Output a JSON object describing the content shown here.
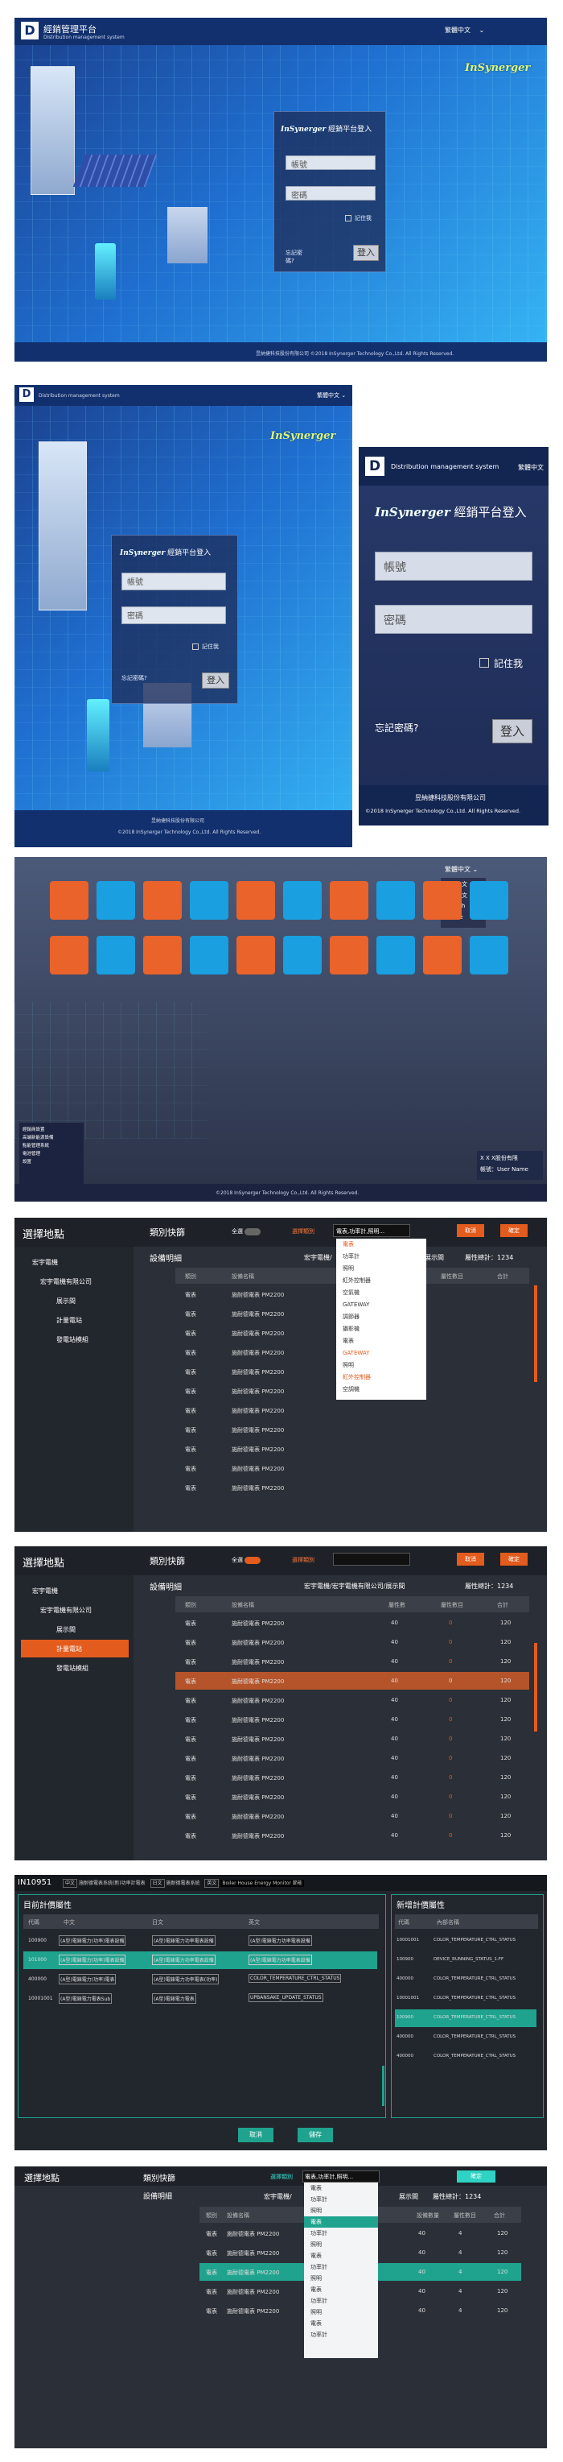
{
  "login1": {
    "brand_title": "經銷管理平台",
    "brand_sub": "Distribution management system",
    "lang": "繁體中文",
    "logo": "InSynerger",
    "box_title": "經銷平台登入",
    "box_logo": "InSynerger",
    "account_placeholder": "帳號",
    "password_placeholder": "密碼",
    "remember": "記住我",
    "forgot": "忘記密碼?",
    "login_btn": "登入",
    "footer": "昱納捷科技股份有限公司   ©2018 InSynerger Technology Co.,Ltd. All Rights Reserved."
  },
  "login2": {
    "brand_sub": "Distribution management system",
    "lang": "繁體中文",
    "logo": "InSynerger",
    "box_logo": "InSynerger",
    "box_title": "經銷平台登入",
    "account_placeholder": "帳號",
    "password_placeholder": "密碼",
    "remember": "記住我",
    "forgot": "忘記密碼?",
    "login_btn": "登入",
    "footer1": "昱納捷科技股份有限公司",
    "footer2": "©2018 InSynerger Technology Co.,Ltd. All Rights Reserved."
  },
  "login3": {
    "brand_sub": "Distribution management system",
    "lang": "繁體中文",
    "box_logo": "InSynerger",
    "box_title": "經銷平台登入",
    "account_placeholder": "帳號",
    "password_placeholder": "密碼",
    "remember": "記住我",
    "forgot": "忘記密碼?",
    "login_btn": "登入",
    "footer1": "昱納捷科技股份有限公司",
    "footer2": "©2018 InSynerger Technology Co.,Ltd. All Rights Reserved."
  },
  "menu": {
    "lang": "繁體中文",
    "lang_options": [
      "繁體中文",
      "簡體中文",
      "English",
      "Online"
    ],
    "user_company": "X X X股份有限",
    "user_label": "帳號：User Name",
    "footer": "©2018 InSynerger Technology Co.,Ltd. All Rights Reserved.",
    "side_links": [
      "經銷商設置",
      "高端新能源設備",
      "點能管理系統",
      "電池管理",
      "設置"
    ]
  },
  "app1": {
    "select_location": "選擇地點",
    "category_shortcut": "類別快篩",
    "all": "全選",
    "chooser": "選擇類別",
    "chosen": "電表,功率計,照明...",
    "cancel": "取消",
    "confirm": "確定",
    "device_detail": "設備明細",
    "path_prefix": "宏宇電機/",
    "path_suffix": "展示間",
    "attr_total": "屬性總計：1234",
    "tree": [
      "宏宇電機",
      "宏宇電機有限公司",
      "展示間",
      "計量電站",
      "發電站模組"
    ],
    "columns": [
      "類別",
      "設備名稱",
      "屬性數目",
      "合計"
    ],
    "rows": [
      "電表",
      "電表",
      "電表",
      "電表",
      "電表",
      "電表",
      "電表",
      "電表",
      "電表",
      "電表",
      "電表"
    ],
    "device": "施耐德電表 PM2200",
    "options": [
      "電表",
      "功率計",
      "照明",
      "紅外控制器",
      "空氣機",
      "GATEWAY",
      "調節器",
      "攝影機",
      "電表",
      "GATEWAY",
      "照明",
      "紅外控制器",
      "空調機"
    ]
  },
  "app2": {
    "select_location": "選擇地點",
    "category_shortcut": "類別快篩",
    "all": "全選",
    "chooser": "選擇類別",
    "cancel": "取消",
    "confirm": "確定",
    "device_detail": "設備明細",
    "path": "宏宇電機/宏宇電機有限公司/展示間",
    "attr_total": "屬性總計：1234",
    "tree": [
      "宏宇電機",
      "宏宇電機有限公司",
      "展示間",
      "計量電站",
      "發電站模組"
    ],
    "columns": [
      "類別",
      "設備名稱",
      "屬性數",
      "屬性數目",
      "合計"
    ],
    "rows": [
      "電表",
      "電表",
      "電表",
      "電表",
      "電表",
      "電表",
      "電表",
      "電表",
      "電表",
      "電表",
      "電表",
      "電表"
    ],
    "device": "施耐德電表 PM2200",
    "n40": "40",
    "n0": "0",
    "n120": "120"
  },
  "app3": {
    "id": "IN10951",
    "tabs": [
      "中文",
      "施耐德電表系統(新)功率計電表",
      "日文",
      "施耐德電表系統",
      "英文",
      "Boiler House Energy Monitor 節能"
    ],
    "left_title": "目前計價屬性",
    "right_title": "新增計價屬性",
    "left_cols": [
      "代碼",
      "中文",
      "日文",
      "英文"
    ],
    "right_cols": [
      "代碼",
      "內部名稱"
    ],
    "left_rows": [
      [
        "100900",
        "(A型)電錶電力(功率)電表設備",
        "(A型)電錶電力功率電表設備",
        "(A型)電錶電力功率電表設備"
      ],
      [
        "101000",
        "(A型)電錶電力(功率)電表設備",
        "(A型)電錶電力功率電表設備",
        "(A型)電錶電力功率電表設備"
      ],
      [
        "400000",
        "(A型)電錶電力(功率)電表",
        "(A型)電錶電力功率電表(功率)",
        "COLOR_TEMPERATURE_CTRL_STATUS"
      ],
      [
        "10001001",
        "(A型)電錶電力電表Sub",
        "(A型)電錶電力電表",
        "UPBANSAKE_UPDATE_STATUS"
      ]
    ],
    "right_rows": [
      [
        "10001001",
        "COLOR_TEMPERATURE_CTRL_STATUS"
      ],
      [
        "100900",
        "DEVICE_RUNNING_STATUS_1-FF"
      ],
      [
        "400000",
        "COLOR_TEMPERATURE_CTRL_STATUS"
      ],
      [
        "10001001",
        "COLOR_TEMPERATURE_CTRL_STATUS"
      ],
      [
        "100900",
        "COLOR_TEMPERATURE_CTRL_STATUS"
      ],
      [
        "400000",
        "COLOR_TEMPERATURE_CTRL_STATUS"
      ],
      [
        "400000",
        "COLOR_TEMPERATURE_CTRL_STATUS"
      ]
    ],
    "cancel": "取消",
    "save": "儲存"
  },
  "app4": {
    "select_location": "選擇地點",
    "category_shortcut": "類別快篩",
    "chooser": "選擇類別",
    "chosen": "電表,功率計,照明...",
    "confirm": "確定",
    "device_detail": "設備明細",
    "path_prefix": "宏宇電機/",
    "path_suffix": "展示間",
    "attr_total": "屬性總計：1234",
    "columns": [
      "類別",
      "設備名稱",
      "設備數量",
      "屬性數目",
      "合計"
    ],
    "rows": [
      "電表",
      "電表",
      "電表",
      "電表",
      "電表"
    ],
    "device": "施耐德電表 PM2200",
    "options": [
      "電表",
      "功率計",
      "照明",
      "電表",
      "功率計",
      "照明",
      "電表",
      "功率計",
      "照明",
      "電表",
      "功率計",
      "照明",
      "電表",
      "功率計"
    ],
    "n40": "40",
    "n4": "4",
    "n120": "120"
  }
}
